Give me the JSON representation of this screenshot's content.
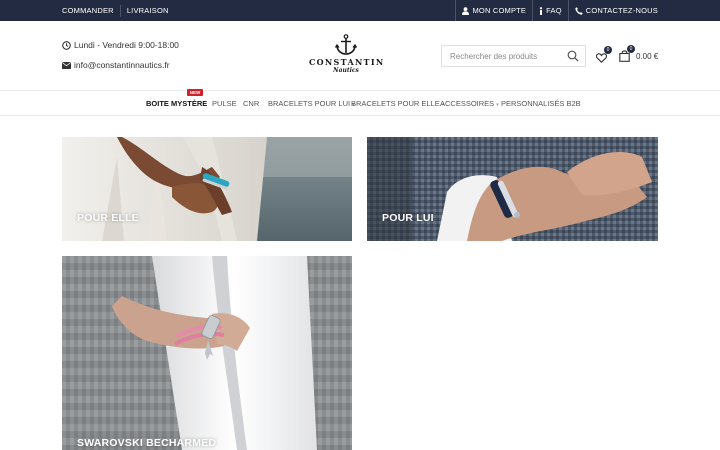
{
  "topbar": {
    "links": [
      "COMMANDER",
      "LIVRAISON"
    ],
    "account": "MON COMPTE",
    "faq": "FAQ",
    "contact": "CONTACTEZ-NOUS"
  },
  "header": {
    "hours": "Lundi - Vendredi 9:00-18:00",
    "email": "info@constantinnautics.fr",
    "logo_name": "CONSTANTIN",
    "logo_sub": "Nautics",
    "search_placeholder": "Rechercher des produits",
    "wishlist_count": "0",
    "cart_count": "0",
    "cart_total": "0.00 €"
  },
  "nav": {
    "badge": "NEW",
    "items": [
      {
        "label": "BOITE MYSTÈRE"
      },
      {
        "label": "PULSE"
      },
      {
        "label": "CNR"
      },
      {
        "label": "BRACELETS POUR LUI"
      },
      {
        "label": "BRACELETS POUR ELLE"
      },
      {
        "label": "ACCESSOIRES"
      },
      {
        "label": "PERSONNALISÉS B2B"
      }
    ]
  },
  "tiles": [
    {
      "label": "POUR ELLE"
    },
    {
      "label": "POUR LUI"
    },
    {
      "label": "SWAROVSKI BECHARMED"
    }
  ],
  "colors": {
    "topbar_bg": "#232b43",
    "new_badge": "#d0212b"
  },
  "icons": [
    "clock-icon",
    "mail-icon",
    "user-icon",
    "info-icon",
    "phone-icon",
    "anchor-logo-icon",
    "search-icon",
    "heart-icon",
    "bag-icon"
  ]
}
